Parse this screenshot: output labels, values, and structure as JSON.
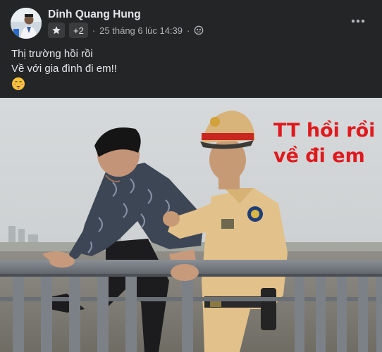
{
  "post": {
    "author": "Dinh Quang Hung",
    "audience_more": "+2",
    "timestamp": "25 tháng 6 lúc 14:39",
    "separator": "·",
    "text_lines": [
      "Thị trường hồi rồi",
      "Về với gia đình đi em!!"
    ],
    "emoji": "face-with-hand-over-mouth-emoji"
  },
  "photo": {
    "caption_line1": "TT hồi rồi",
    "caption_line2": "về đi em",
    "caption_color": "#e0191d"
  },
  "colors": {
    "background": "#242526",
    "primary_text": "#e4e6eb",
    "secondary_text": "#b0b3b8",
    "chip_bg": "#3a3b3c"
  },
  "icons": {
    "more": "more-options-icon",
    "star": "star-icon",
    "audience": "friends-audience-icon"
  }
}
